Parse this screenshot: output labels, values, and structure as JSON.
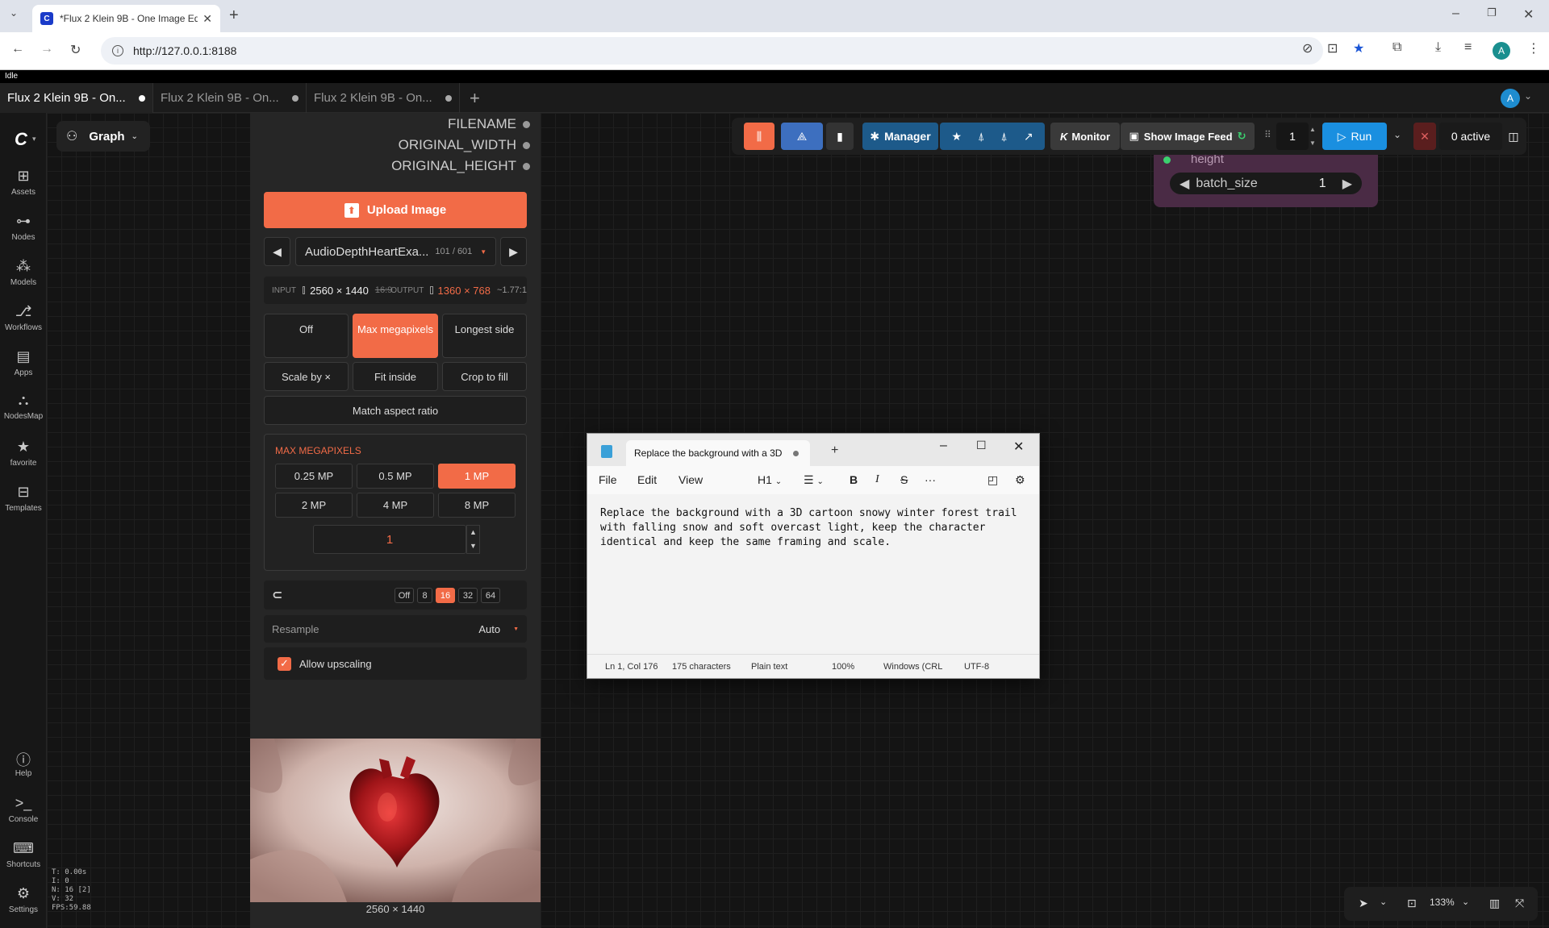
{
  "browser": {
    "tab_title": "*Flux 2 Klein 9B - One Image Ed",
    "url": "http://127.0.0.1:8188",
    "profile_initial": "A"
  },
  "app": {
    "status": "Idle",
    "workflow_tabs": [
      {
        "label": "Flux 2 Klein 9B - On...",
        "active": true
      },
      {
        "label": "Flux 2 Klein 9B - On...",
        "active": false
      },
      {
        "label": "Flux 2 Klein 9B - On...",
        "active": false
      }
    ],
    "user_initial": "A",
    "graph_label": "Graph"
  },
  "sidebar": {
    "items": [
      {
        "label": "Assets",
        "icon": "image-icon"
      },
      {
        "label": "Nodes",
        "icon": "nodes-icon"
      },
      {
        "label": "Models",
        "icon": "models-icon"
      },
      {
        "label": "Workflows",
        "icon": "workflow-icon"
      },
      {
        "label": "Apps",
        "icon": "apps-icon"
      },
      {
        "label": "NodesMap",
        "icon": "nodesmap-icon"
      },
      {
        "label": "favorite",
        "icon": "star-icon"
      },
      {
        "label": "Templates",
        "icon": "templates-icon"
      },
      {
        "label": "Help",
        "icon": "help-icon"
      },
      {
        "label": "Console",
        "icon": "console-icon"
      },
      {
        "label": "Shortcuts",
        "icon": "keyboard-icon"
      },
      {
        "label": "Settings",
        "icon": "gear-icon"
      }
    ],
    "stats": [
      "T: 0.00s",
      "I: 0",
      "N: 16 [2]",
      "V: 32",
      "FPS:59.88"
    ]
  },
  "node": {
    "outputs": [
      "FILENAME",
      "ORIGINAL_WIDTH",
      "ORIGINAL_HEIGHT"
    ],
    "upload_label": "Upload Image",
    "image_name": "AudioDepthHeartExa...",
    "image_count": "101 / 601",
    "input_label": "INPUT",
    "input_size": "2560 × 1440",
    "input_ratio": "16:9",
    "output_label": "OUTPUT",
    "output_size": "1360 × 768",
    "output_ratio": "~1.77:1",
    "modes": [
      "Off",
      "Max megapixels",
      "Longest side",
      "Scale by ×",
      "Fit inside",
      "Crop to fill",
      "Match aspect ratio"
    ],
    "active_mode": "Max megapixels",
    "mp_title": "MAX MEGAPIXELS",
    "mp_options": [
      "0.25 MP",
      "0.5 MP",
      "1 MP",
      "2 MP",
      "4 MP",
      "8 MP"
    ],
    "mp_active": "1 MP",
    "mp_value": "1",
    "snap_options": [
      "Off",
      "8",
      "16",
      "32",
      "64"
    ],
    "snap_active": "16",
    "resample_label": "Resample",
    "resample_value": "Auto",
    "upscale_label": "Allow upscaling",
    "upscale_checked": true,
    "preview_caption": "2560 × 1440"
  },
  "toolbar": {
    "manager_label": "Manager",
    "monitor_label": "Monitor",
    "image_feed_label": "Show Image Feed",
    "queue_count": "1",
    "run_label": "Run",
    "active_label": "0 active"
  },
  "batch_node": {
    "height_label": "height",
    "widget_label": "batch_size",
    "widget_value": "1"
  },
  "notepad": {
    "tab_title": "Replace the background with a 3D",
    "menus": [
      "File",
      "Edit",
      "View"
    ],
    "heading_select": "H1",
    "text": "Replace the background with a 3D cartoon snowy winter forest trail with falling snow and soft overcast light, keep the character identical and keep the same framing and scale.",
    "status": [
      "Ln 1, Col 176",
      "175 characters",
      "Plain text",
      "100%",
      "Windows (CRL",
      "UTF-8"
    ]
  },
  "canvas_controls": {
    "zoom": "133%"
  },
  "colors": {
    "accent": "#f26b47",
    "run_blue": "#1a8fe0",
    "manager_blue": "#1d5a8a"
  }
}
